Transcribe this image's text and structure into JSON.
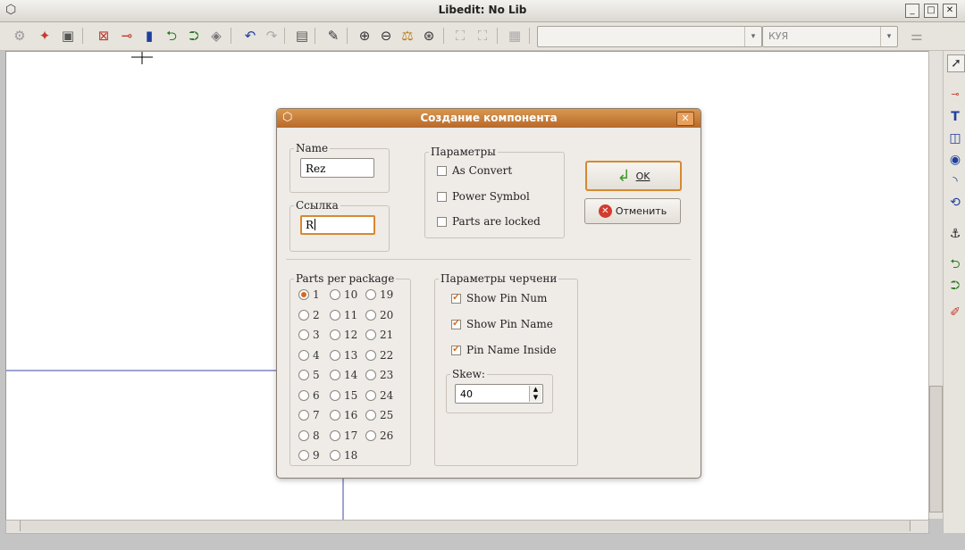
{
  "window": {
    "title": "Libedit: No Lib",
    "icon": "app-icon",
    "controls": [
      "_",
      "□",
      "✕"
    ]
  },
  "toolbar": {
    "icons": [
      "new-lib-icon",
      "chip-icon",
      "save-icon",
      "open-icon",
      "import-icon",
      "export-icon",
      "new-component-icon",
      "load-icon",
      "save-component-icon",
      "undo-icon",
      "redo-icon",
      "zoom-in-icon",
      "zoom-out-icon",
      "zoom-refresh-icon",
      "zoom-fit-icon",
      "properties-icon",
      "doc-icon",
      "view-icon"
    ],
    "part_combo_value": "",
    "unit_combo_value": "КУЯ"
  },
  "dialog": {
    "title": "Создание компонента",
    "name": {
      "label": "Name",
      "value": "Rez"
    },
    "reference": {
      "label": "Ссылка",
      "value": "R"
    },
    "params": {
      "label": "Параметры",
      "items": [
        {
          "label": "As Convert",
          "checked": false
        },
        {
          "label": "Power Symbol",
          "checked": false
        },
        {
          "label": "Parts are locked",
          "checked": false
        }
      ]
    },
    "ok_label": "OK",
    "cancel_label": "Отменить",
    "parts": {
      "label": "Parts per package",
      "selected": "1",
      "options": [
        "1",
        "10",
        "19",
        "2",
        "11",
        "20",
        "3",
        "12",
        "21",
        "4",
        "13",
        "22",
        "5",
        "14",
        "23",
        "6",
        "15",
        "24",
        "7",
        "16",
        "25",
        "8",
        "17",
        "26",
        "9",
        "18"
      ]
    },
    "drawing": {
      "label": "Параметры черчени",
      "items": [
        {
          "label": "Show Pin Num",
          "checked": true
        },
        {
          "label": "Show Pin Name",
          "checked": true
        },
        {
          "label": "Pin Name Inside",
          "checked": true
        }
      ],
      "skew_label": "Skew:",
      "skew_value": "40"
    }
  },
  "right_toolbar": {
    "icons": [
      "select-arrow-icon",
      "pin-icon",
      "text-icon",
      "rectangle-icon",
      "circle-icon",
      "arc-icon",
      "polyline-icon",
      "anchor-icon",
      "import-icon",
      "export-icon",
      "delete-icon"
    ]
  },
  "colors": {
    "accent": "#d7892f",
    "dialog_title": "#c07a36",
    "canvas_line": "#3d45a8"
  }
}
